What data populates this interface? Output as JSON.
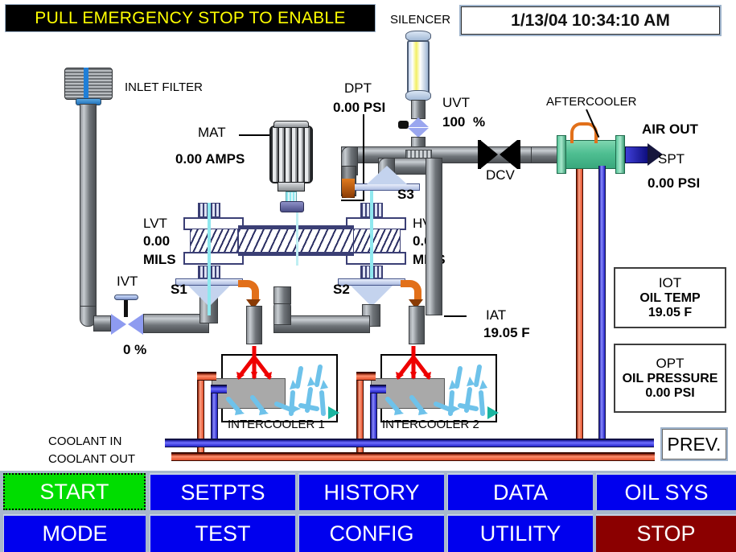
{
  "header": {
    "alarm_text": "PULL EMERGENCY STOP TO ENABLE",
    "datetime": "1/13/04 10:34:10 AM"
  },
  "schematic": {
    "inlet_filter_label": "INLET FILTER",
    "silencer_label": "SILENCER",
    "aftercooler_label": "AFTERCOOLER",
    "air_out_label": "AIR OUT",
    "dcv_label": "DCV",
    "s1_label": "S1",
    "s2_label": "S2",
    "s3_label": "S3",
    "intercooler1_label": "INTERCOOLER 1",
    "intercooler2_label": "INTERCOOLER 2",
    "coolant_in_label": "COOLANT IN",
    "coolant_out_label": "COOLANT OUT"
  },
  "tags": {
    "mat": {
      "name": "MAT",
      "value": "0.00 AMPS"
    },
    "dpt": {
      "name": "DPT",
      "value": "0.00 PSI"
    },
    "uvt": {
      "name": "UVT",
      "value": "100",
      "unit": "%"
    },
    "spt": {
      "name": "SPT",
      "value": "0.00 PSI"
    },
    "lvt": {
      "name": "LVT",
      "value": "0.00",
      "unit": "MILS"
    },
    "hvt": {
      "name": "HVT",
      "value": "0.00",
      "unit": "MILS"
    },
    "ivt": {
      "name": "IVT",
      "value": "0 %"
    },
    "iat": {
      "name": "IAT",
      "value": "19.05 F"
    }
  },
  "panels": {
    "iot": {
      "tag": "IOT",
      "title": "OIL TEMP",
      "value": "19.05 F"
    },
    "opt": {
      "tag": "OPT",
      "title": "OIL PRESSURE",
      "value": "0.00 PSI"
    },
    "prev_button": "PREV."
  },
  "buttons": {
    "row1": [
      {
        "label": "START",
        "style": "green"
      },
      {
        "label": "SETPTS",
        "style": "blue"
      },
      {
        "label": "HISTORY",
        "style": "blue"
      },
      {
        "label": "DATA",
        "style": "blue"
      },
      {
        "label": "OIL SYS",
        "style": "blue"
      }
    ],
    "row2": [
      {
        "label": "MODE",
        "style": "blue"
      },
      {
        "label": "TEST",
        "style": "blue"
      },
      {
        "label": "CONFIG",
        "style": "blue"
      },
      {
        "label": "UTILITY",
        "style": "blue"
      },
      {
        "label": "STOP",
        "style": "red"
      }
    ]
  },
  "colors": {
    "alarm_bg": "#000000",
    "alarm_fg": "#ffff00",
    "button_blue": "#0000ee",
    "button_green": "#00dd00",
    "button_red": "#8b0000",
    "coolant_in": "#2323c8",
    "coolant_out": "#e2502b",
    "aftercooler": "#4fbf92"
  }
}
